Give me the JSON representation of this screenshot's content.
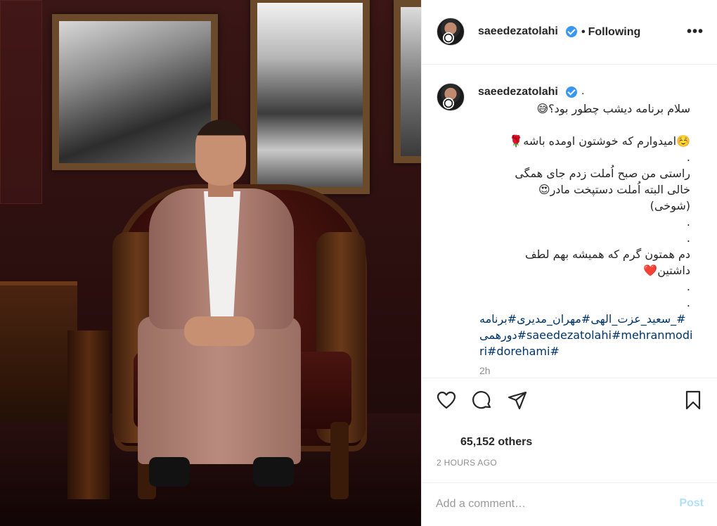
{
  "post": {
    "username": "saeedezatolahi",
    "follow_status": "Following",
    "follow_separator": "•",
    "more_label": "•••",
    "caption_username": "saeedezatolahi",
    "caption_trailing": ".",
    "caption_lines": [
      "سلام برنامه دیشب چطور بود؟😅",
      "",
      "☺️امیدوارم که خوشتون اومده باشه🌹",
      ".",
      "راستی من صبح اُملت زدم جای همگی",
      "خالی البته اُملت دستپخت مادر😍",
      "(شوخی)",
      ".",
      ".",
      "دم همتون گرم که همیشه بهم لطف",
      "داشتین❤️",
      ".",
      "."
    ],
    "hashtag_lines": [
      "سعید_عزت_الهی#مهران_مدیری#برنامه_#",
      "دورهمی#saeedezatolahi#mehranmodi",
      "ri#dorehami#"
    ],
    "caption_time": "2h",
    "likes_text": "65,152 others",
    "time_ago": "2 HOURS AGO",
    "comment_placeholder": "Add a comment…",
    "post_label": "Post"
  },
  "icons": {
    "like": "heart-icon",
    "comment": "speech-bubble-icon",
    "share": "paper-plane-icon",
    "save": "bookmark-icon",
    "verified": "verified-badge-icon"
  },
  "colors": {
    "verified": "#3897f0",
    "hashtag": "#003569",
    "post_disabled": "#b2dffc",
    "muted": "#8e8e8e",
    "border": "#efefef"
  }
}
